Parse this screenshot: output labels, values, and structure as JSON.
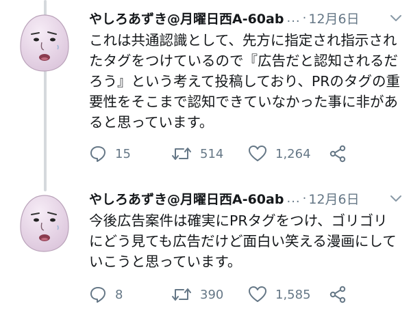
{
  "tweets": [
    {
      "author": "やしろあずき@月曜日西A-60ab",
      "ellipsis": "...",
      "separator": "·",
      "date": "12月6日",
      "text": "これは共通認識として、先方に指定され指示されたタグをつけているので『広告だと認知されるだろう』という考えて投稿しており、PRのタグの重要性をそこまで認知できていなかった事に非があると思っています。",
      "actions": {
        "replies": "15",
        "retweets": "514",
        "likes": "1,264"
      }
    },
    {
      "author": "やしろあずき@月曜日西A-60ab",
      "ellipsis": "...",
      "separator": "·",
      "date": "12月6日",
      "text": "今後広告案件は確実にPRタグをつけ、ゴリゴリにどう見ても広告だけど面白い笑える漫画にしていこうと思っています。",
      "actions": {
        "replies": "8",
        "retweets": "390",
        "likes": "1,585"
      }
    }
  ],
  "icons": {
    "reply": "reply-icon",
    "retweet": "retweet-icon",
    "like": "heart-icon",
    "share": "share-icon",
    "caret": "chevron-down-icon"
  },
  "colors": {
    "text": "#14171a",
    "muted": "#657786",
    "thread_line": "#d5d9dd",
    "avatar_skin": "#ead8ea"
  }
}
